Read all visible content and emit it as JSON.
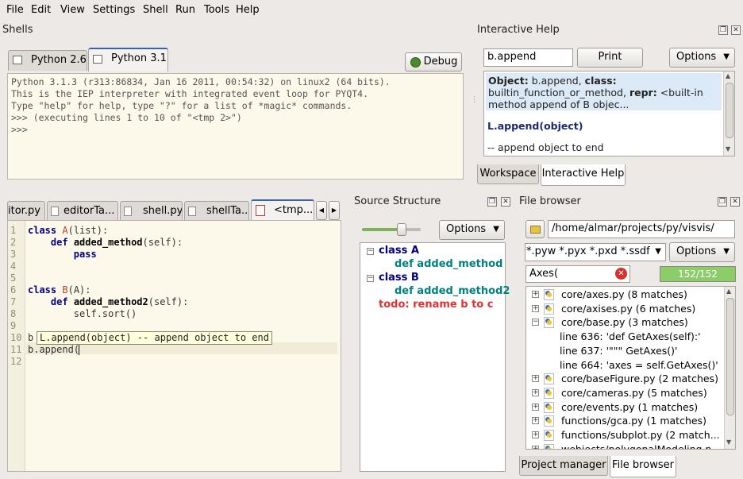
{
  "menu": [
    "File",
    "Edit",
    "View",
    "Settings",
    "Shell",
    "Run",
    "Tools",
    "Help"
  ],
  "shells": {
    "title": "Shells",
    "tabs": [
      "Python 2.6",
      "Python 3.1"
    ],
    "debug_label": "Debug",
    "lines": [
      "Python 3.1.3 (r313:86834, Jan 16 2011, 00:54:32) on linux2 (64 bits).",
      "This is the IEP interpreter with integrated event loop for PYQT4.",
      "Type \"help\" for help, type \"?\" for a list of *magic* commands.",
      ">>> (executing lines 1 to 10 of \"<tmp 2>\")",
      ">>> "
    ]
  },
  "interactive_help": {
    "title": "Interactive Help",
    "query": "b.append",
    "print_label": "Print",
    "options_label": "Options",
    "object_label": "Object:",
    "object_value": "b.append,",
    "class_label": "class:",
    "class_value": "builtin_function_or_method,",
    "repr_label": "repr:",
    "repr_value": "<built-in method append of B objec...",
    "signature": "L.append(object)",
    "description": "-- append object to end",
    "tabs": [
      "Workspace",
      "Interactive Help"
    ]
  },
  "editor": {
    "tabs": [
      "itor.py",
      "editorTa...",
      "shell.py",
      "shellTa...",
      "<tmp..."
    ],
    "line_numbers": [
      "1",
      "2",
      "3",
      "4",
      "5",
      "6",
      "7",
      "8",
      "9",
      "10",
      "11",
      "12"
    ],
    "calltip": "L.append(object) -- append object to end",
    "line10_prefix": "b",
    "line11": "b.append("
  },
  "source_structure": {
    "title": "Source Structure",
    "options_label": "Options",
    "items": [
      {
        "label": "class A",
        "kind": "class"
      },
      {
        "label": "def added_method",
        "kind": "def"
      },
      {
        "label": "class B",
        "kind": "class"
      },
      {
        "label": "def added_method2",
        "kind": "def"
      },
      {
        "label": "todo: rename b to c",
        "kind": "todo"
      }
    ]
  },
  "file_browser": {
    "title": "File browser",
    "path": "/home/almar/projects/py/visvis/",
    "filter": "*.pyw *.pyx *.pxd *.ssdf",
    "options_label": "Options",
    "search": "Axes(",
    "progress": "152/152",
    "progress_fraction": 1.0,
    "items": [
      {
        "label": "core/axes.py (8 matches)",
        "expanded": false
      },
      {
        "label": "core/axises.py (6 matches)",
        "expanded": false
      },
      {
        "label": "core/base.py (3 matches)",
        "expanded": true
      },
      {
        "label": "line 636: 'def GetAxes(self):'",
        "child": true
      },
      {
        "label": "line 637: '\"\"\" GetAxes()'",
        "child": true
      },
      {
        "label": "line 664: 'axes = self.GetAxes()'",
        "child": true
      },
      {
        "label": "core/baseFigure.py (2 matches)",
        "expanded": false
      },
      {
        "label": "core/cameras.py (5 matches)",
        "expanded": false
      },
      {
        "label": "core/events.py (1 matches)",
        "expanded": false
      },
      {
        "label": "functions/gca.py (1 matches)",
        "expanded": false
      },
      {
        "label": "functions/subplot.py (2 match...",
        "expanded": false
      },
      {
        "label": "webjects/polygonalModeling.p...",
        "expanded": false
      }
    ],
    "tabs": [
      "Project manager",
      "File browser"
    ]
  },
  "colors": {
    "class": "#000080",
    "def": "#008080",
    "todo": "#e03030",
    "shell_bg": "#fdf9ea",
    "help_highlight": "#dceaf7",
    "progress": "#8ccd6a"
  }
}
